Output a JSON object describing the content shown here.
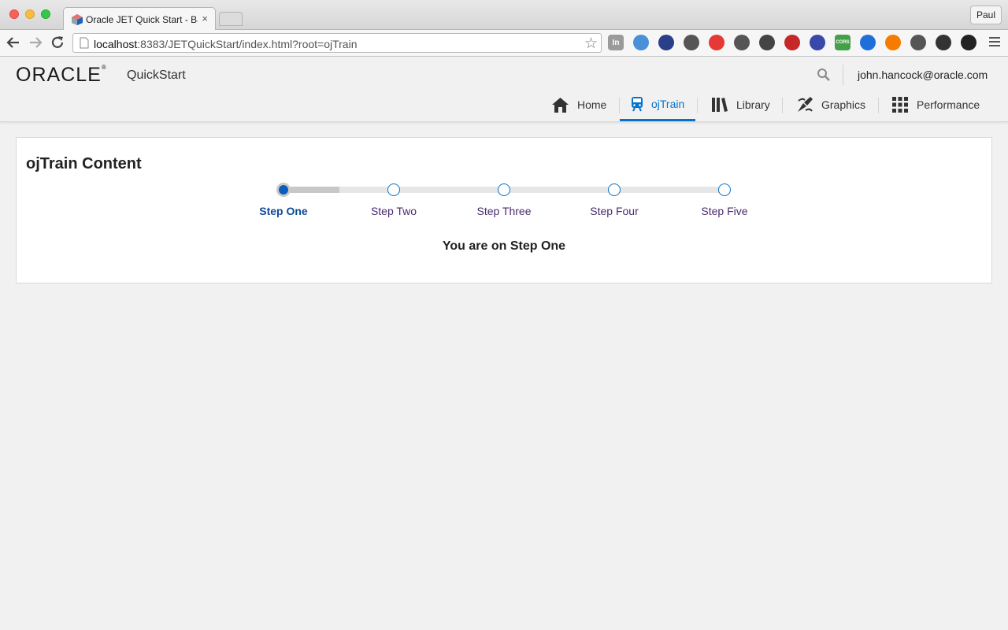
{
  "browser": {
    "tab_title": "Oracle JET Quick Start - Ba",
    "tab_close": "×",
    "url_host": "localhost",
    "url_rest": ":8383/JETQuickStart/index.html?root=ojTrain",
    "profile_name": "Paul",
    "bookmark_star": "☆",
    "extensions": [
      {
        "icon": "in-icon",
        "text": "In",
        "color": "#9a9a9a"
      },
      {
        "icon": "folder-icon",
        "text": "",
        "color": "#4a8fd8"
      },
      {
        "icon": "speedometer-icon",
        "text": "",
        "color": "#2b3e8a"
      },
      {
        "icon": "sync-icon",
        "text": "",
        "color": "#555555"
      },
      {
        "icon": "download-icon",
        "text": "",
        "color": "#e53935"
      },
      {
        "icon": "info-icon",
        "text": "",
        "color": "#555555"
      },
      {
        "icon": "pocket-icon",
        "text": "",
        "color": "#444444"
      },
      {
        "icon": "heart-icon",
        "text": "",
        "color": "#c62828"
      },
      {
        "icon": "c-icon",
        "text": "",
        "color": "#3949ab"
      },
      {
        "icon": "cors-icon",
        "text": "CORS",
        "color": "#43a047"
      },
      {
        "icon": "resize-icon",
        "text": "",
        "color": "#1e6fd9"
      },
      {
        "icon": "lifebuoy-icon",
        "text": "",
        "color": "#f57c00"
      },
      {
        "icon": "off-icon",
        "text": "",
        "color": "#555555"
      },
      {
        "icon": "binoculars-icon",
        "text": "",
        "color": "#333333"
      },
      {
        "icon": "color-wheel-icon",
        "text": "",
        "color": "#222222"
      }
    ]
  },
  "app": {
    "brand": "ORACLE",
    "brand_mark": "®",
    "app_name": "QuickStart",
    "user_email": "john.hancock@oracle.com",
    "accent_color": "#0572ce",
    "nav": [
      {
        "label": "Home",
        "icon": "home-icon",
        "selected": false
      },
      {
        "label": "ojTrain",
        "icon": "train-icon",
        "selected": true
      },
      {
        "label": "Library",
        "icon": "library-icon",
        "selected": false
      },
      {
        "label": "Graphics",
        "icon": "graphics-icon",
        "selected": false
      },
      {
        "label": "Performance",
        "icon": "grid-icon",
        "selected": false
      }
    ]
  },
  "content": {
    "title": "ojTrain Content",
    "steps": [
      {
        "label": "Step One",
        "current": true
      },
      {
        "label": "Step Two",
        "current": false
      },
      {
        "label": "Step Three",
        "current": false
      },
      {
        "label": "Step Four",
        "current": false
      },
      {
        "label": "Step Five",
        "current": false
      }
    ],
    "current_step_fraction": 0.125,
    "message": "You are on Step One"
  }
}
